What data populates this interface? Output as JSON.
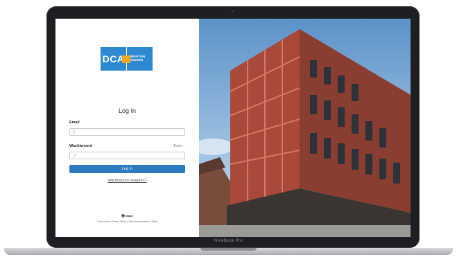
{
  "device": {
    "model": "NoteBook Pro"
  },
  "logo": {
    "left_text": "DCA",
    "right_line1": "MEER DAN",
    "right_line2": "BOUWEN",
    "colors": {
      "blue": "#2d8ad0",
      "orange": "#f3a81e"
    }
  },
  "login": {
    "title": "Log In",
    "email_label": "Email",
    "password_label": "Wachtwoord",
    "show_password": "Toon",
    "submit": "Log In",
    "forgot": "Wachtwoord vergeten?"
  },
  "footer": {
    "brand": "zippo",
    "links": "Cookie beleid • Privacy beleid • Gebruiksvoorwaarden • Status"
  },
  "accent_color": "#2e7ac1"
}
